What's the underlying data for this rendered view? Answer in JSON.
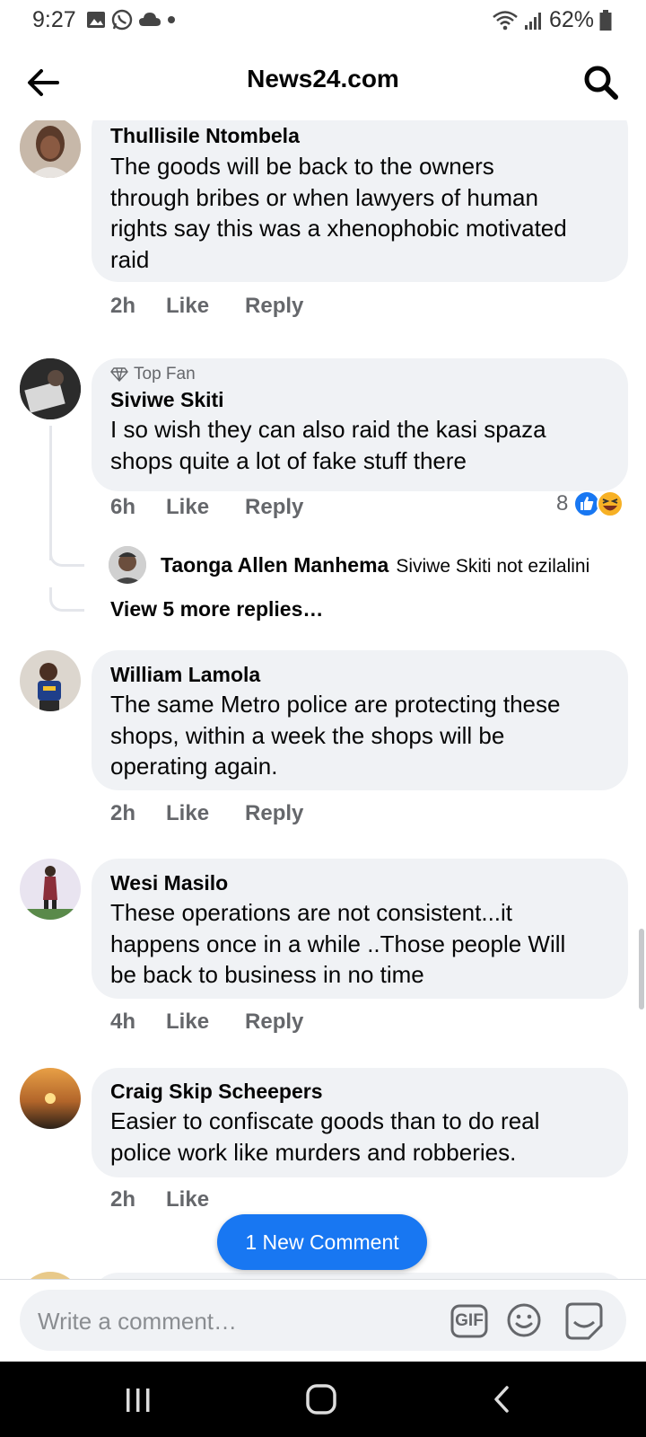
{
  "status_bar": {
    "time": "9:27",
    "battery": "62%"
  },
  "header": {
    "title": "News24.com"
  },
  "comments": [
    {
      "name": "Thullisile Ntombela",
      "lines": [
        "The goods will be back to the owners",
        "through bribes or when lawyers of human",
        "rights say this was a xhenophobic motivated",
        "raid"
      ],
      "time": "2h",
      "like": "Like",
      "reply": "Reply"
    },
    {
      "badge": "Top Fan",
      "name": "Siviwe Skiti",
      "lines": [
        "I so wish they can also raid the kasi spaza",
        "shops quite a lot of fake stuff there"
      ],
      "time": "6h",
      "like": "Like",
      "reply": "Reply",
      "reactions_count": "8",
      "reply_preview": {
        "name": "Taonga Allen Manhema",
        "text": "Siviwe Skiti not ezilalini"
      },
      "view_more": "View 5 more replies…"
    },
    {
      "name": "William Lamola",
      "lines": [
        "The same Metro police are protecting these",
        "shops, within a week the shops will be",
        "operating again."
      ],
      "time": "2h",
      "like": "Like",
      "reply": "Reply"
    },
    {
      "name": "Wesi Masilo",
      "lines": [
        "These operations are not consistent...it",
        "happens once in a while ..Those people Will",
        "be back to business in no time"
      ],
      "time": "4h",
      "like": "Like",
      "reply": "Reply"
    },
    {
      "name": "Craig Skip Scheepers",
      "lines": [
        "Easier to confiscate goods than to do real",
        "police work like murders and robberies."
      ],
      "time": "2h",
      "like": "Like"
    }
  ],
  "new_comment_pill": "1 New Comment",
  "composer": {
    "placeholder": "Write a comment…",
    "gif_label": "GIF"
  },
  "colors": {
    "accent": "#1877f2",
    "bubble": "#f0f2f5",
    "meta_text": "#65676b"
  },
  "icons": [
    "back-arrow-icon",
    "search-icon",
    "diamond-icon",
    "like-reaction-icon",
    "haha-reaction-icon",
    "gif-icon",
    "emoji-icon",
    "sticker-icon",
    "recent-apps-icon",
    "home-icon",
    "nav-back-icon"
  ]
}
